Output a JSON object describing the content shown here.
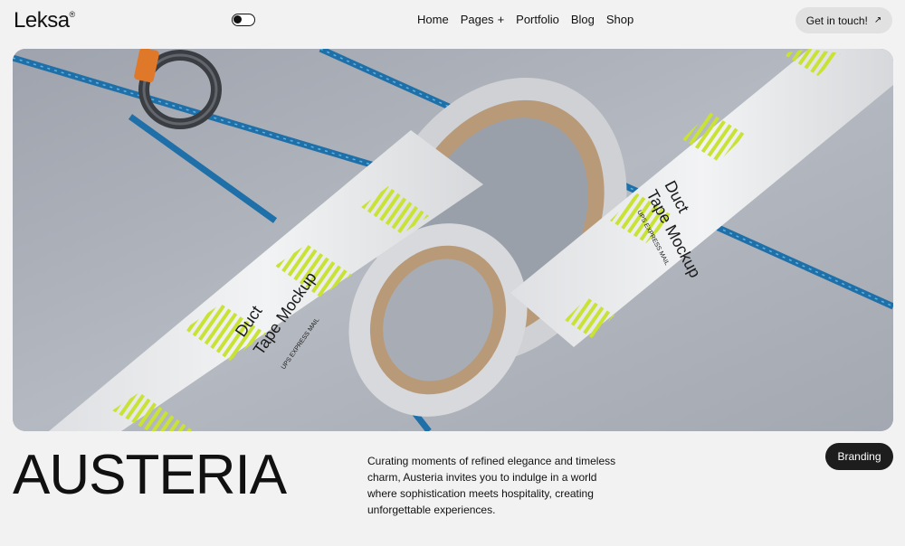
{
  "header": {
    "logo": "Leksa",
    "logo_mark": "®",
    "nav": [
      {
        "label": "Home"
      },
      {
        "label": "Pages",
        "suffix": "+"
      },
      {
        "label": "Portfolio"
      },
      {
        "label": "Blog"
      },
      {
        "label": "Shop"
      }
    ],
    "cta_label": "Get in touch!",
    "cta_icon": "arrow-up-right-icon"
  },
  "hero": {
    "tape_title_line1": "Duct",
    "tape_title_line2": "Tape Mockup",
    "tape_subtitle": "UPS EXPRESS MAIL",
    "colors": {
      "background": "#a9adb6",
      "tape": "#e9eaec",
      "stripe": "#c9e234",
      "rope": "#1f6fa8",
      "cardboard": "#b89a78"
    }
  },
  "project": {
    "title": "AUSTERIA",
    "description": "Curating moments of refined elegance and timeless charm, Austeria invites you to indulge in a world where sophistication meets hospitality, creating unforgettable experiences.",
    "tag": "Branding"
  }
}
